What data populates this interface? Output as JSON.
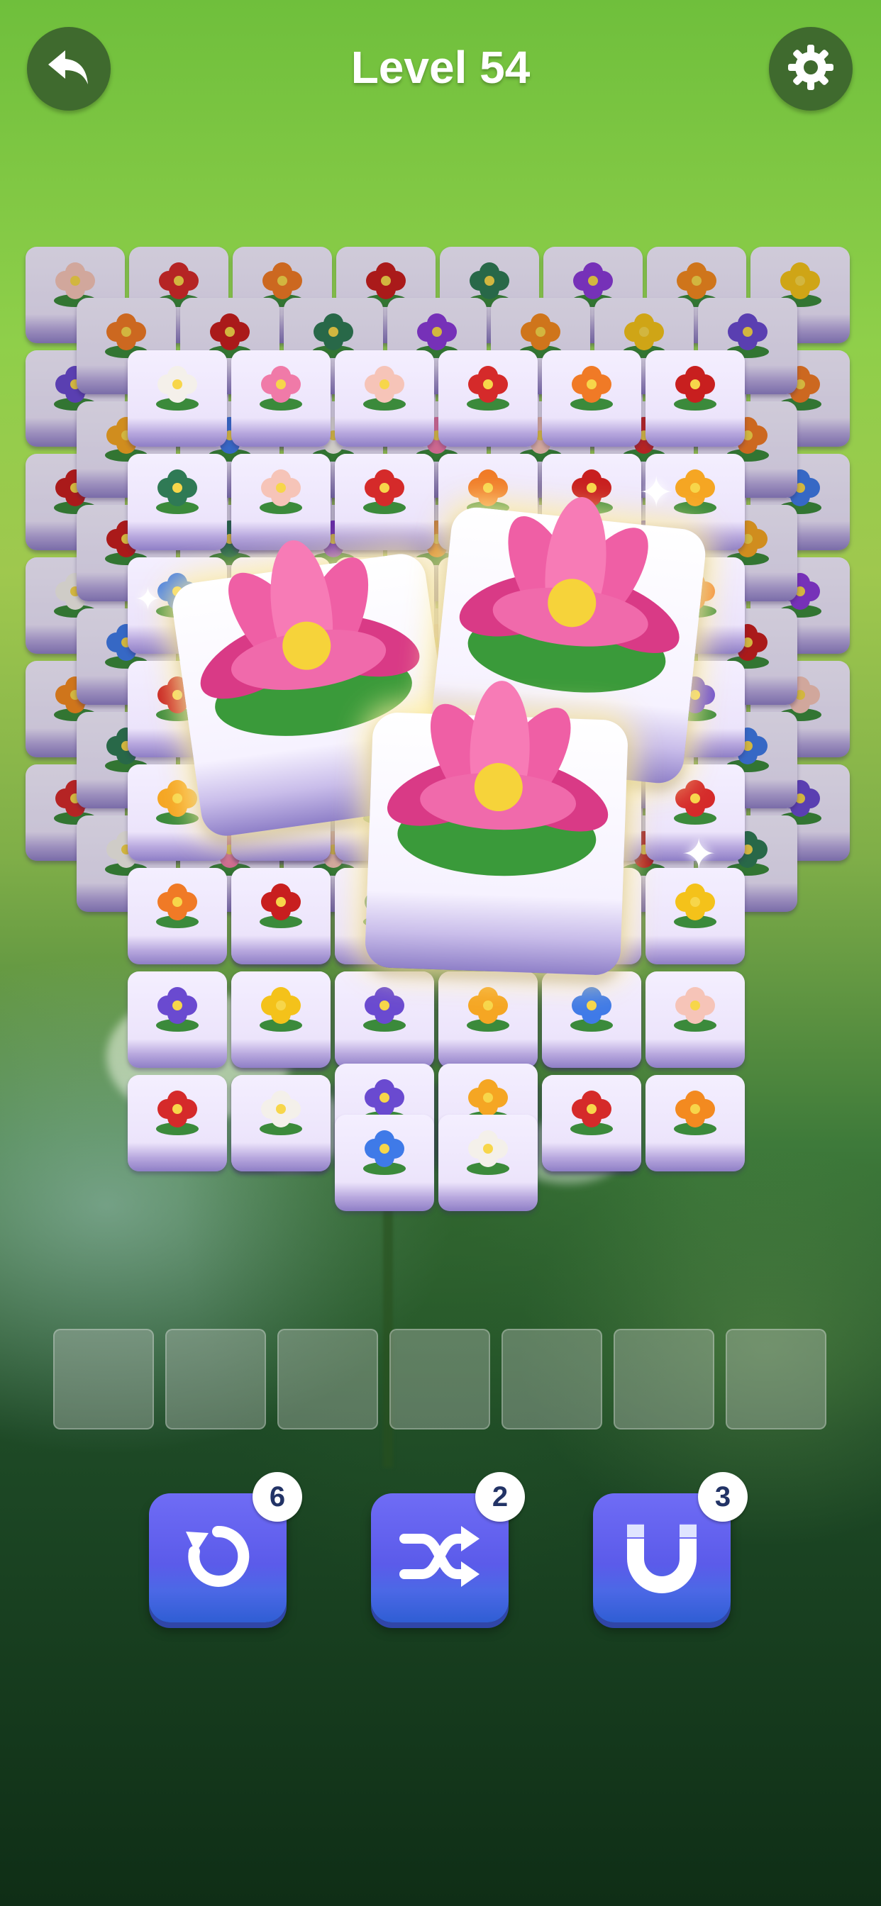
{
  "header": {
    "title": "Level 54",
    "back_icon": "back-arrow-icon",
    "settings_icon": "gear-icon"
  },
  "board": {
    "selected_tile": "lotus",
    "tile_flowers": [
      "peach-blossom",
      "orange-marigold",
      "succulent",
      "orange-poppy",
      "purple-iris",
      "blue-hydrangea",
      "pink-peony",
      "red-rose",
      "red-poppy",
      "purple-violet",
      "sunflower",
      "tulip",
      "calla-lily"
    ]
  },
  "slots": {
    "count": 7,
    "filled": 0
  },
  "powerups": [
    {
      "name": "undo",
      "icon": "undo-icon",
      "count": "6"
    },
    {
      "name": "shuffle",
      "icon": "shuffle-icon",
      "count": "2"
    },
    {
      "name": "magnet",
      "icon": "magnet-icon",
      "count": "3"
    }
  ],
  "colors": {
    "button_bg": "#3f6a2e",
    "powerup_bg": "#5b5bea",
    "tile_face": "#ece4fb",
    "lotus_pink": "#ec4f9a"
  }
}
